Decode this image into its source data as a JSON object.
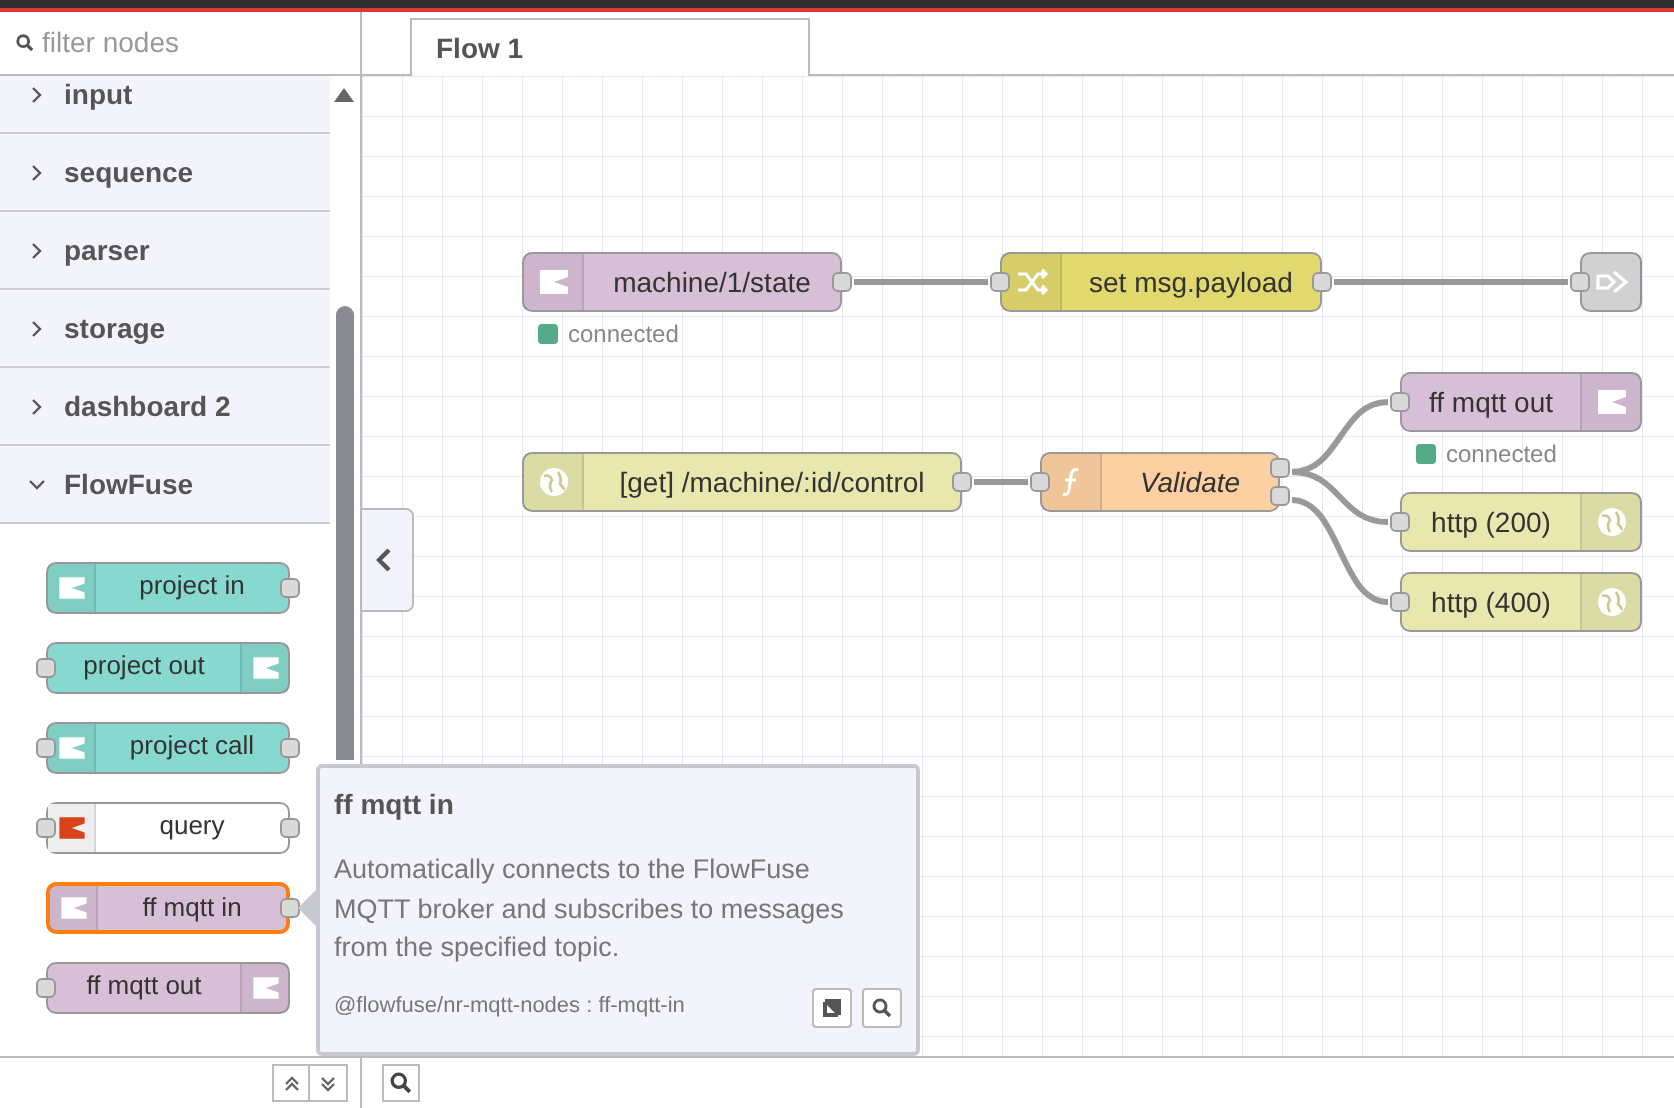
{
  "palette": {
    "search": {
      "placeholder": "filter nodes"
    },
    "categories": [
      {
        "label": "input",
        "expanded": false
      },
      {
        "label": "sequence",
        "expanded": false
      },
      {
        "label": "parser",
        "expanded": false
      },
      {
        "label": "storage",
        "expanded": false
      },
      {
        "label": "dashboard 2",
        "expanded": false
      },
      {
        "label": "FlowFuse",
        "expanded": true
      }
    ],
    "nodes": [
      {
        "label": "project in",
        "kind": "mqtt",
        "color": "#87d8cf",
        "input": false,
        "output": true,
        "selected": false
      },
      {
        "label": "project out",
        "kind": "mqtt",
        "color": "#87d8cf",
        "input": true,
        "output": false,
        "selected": false
      },
      {
        "label": "project call",
        "kind": "mqtt",
        "color": "#87d8cf",
        "input": true,
        "output": true,
        "selected": false
      },
      {
        "label": "query",
        "kind": "query",
        "color": "#ffffff",
        "input": true,
        "output": true,
        "selected": false
      },
      {
        "label": "ff mqtt in",
        "kind": "mqtt",
        "color": "#d8bfd8",
        "input": false,
        "output": true,
        "selected": true
      },
      {
        "label": "ff mqtt out",
        "kind": "mqtt",
        "color": "#d8bfd8",
        "input": true,
        "output": false,
        "selected": false
      }
    ]
  },
  "tabs": [
    {
      "label": "Flow 1",
      "selected": true
    }
  ],
  "canvas": {
    "nodes": [
      {
        "label": "machine/1/state",
        "kind": "mqtt",
        "color": "#d8bfd8",
        "input": false,
        "output": true,
        "extra_output": false,
        "italic": false,
        "status": {
          "text": "connected",
          "color": "#55aa88"
        }
      },
      {
        "label": "set msg.payload",
        "kind": "change",
        "color": "#e2d96e",
        "input": true,
        "output": true,
        "extra_output": false,
        "italic": false
      },
      {
        "kind": "link",
        "color": "#dddddd",
        "input": true,
        "output": false,
        "extra_output": false
      },
      {
        "label": "[get] /machine/:id/control",
        "kind": "http",
        "color": "#e7e7ae",
        "input": false,
        "output": true,
        "extra_output": false,
        "italic": false
      },
      {
        "label": "Validate",
        "kind": "function",
        "color": "#fdd0a2",
        "input": true,
        "output": true,
        "extra_output": true,
        "italic": true
      },
      {
        "label": "ff mqtt out",
        "kind": "mqtt",
        "color": "#d8bfd8",
        "input": true,
        "output": false,
        "extra_output": false,
        "italic": false,
        "status": {
          "text": "connected",
          "color": "#55aa88"
        }
      },
      {
        "label": "http (200)",
        "kind": "http",
        "color": "#e7e7ae",
        "input": true,
        "output": false,
        "extra_output": false,
        "italic": false
      },
      {
        "label": "http (400)",
        "kind": "http",
        "color": "#e7e7ae",
        "input": true,
        "output": false,
        "extra_output": false,
        "italic": false
      }
    ]
  },
  "tooltip": {
    "title": "ff mqtt in",
    "description": "Automatically connects to the FlowFuse MQTT broker and subscribes to messages from the specified topic.",
    "module": "@flowfuse/nr-mqtt-nodes : ff-mqtt-in"
  }
}
